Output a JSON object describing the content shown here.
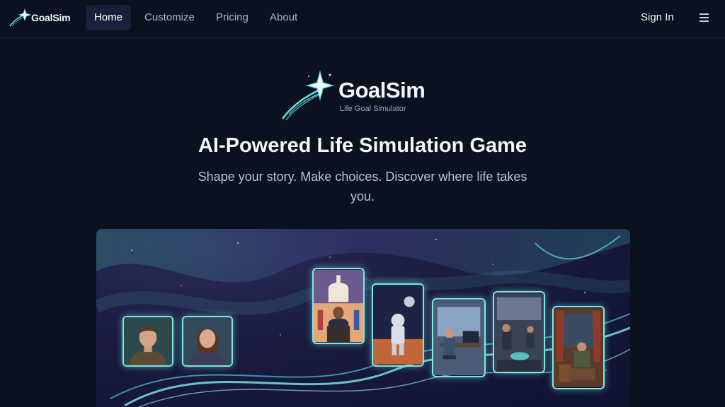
{
  "nav": {
    "brand": "GoalSim",
    "links": [
      {
        "label": "Home",
        "active": true
      },
      {
        "label": "Customize"
      },
      {
        "label": "Pricing"
      },
      {
        "label": "About"
      }
    ],
    "sign_in": "Sign In",
    "menu_icon": "hamburger-icon"
  },
  "hero": {
    "logo_title": "GoalSim",
    "logo_subtitle": "Life Goal Simulator",
    "headline": "AI-Powered Life Simulation Game",
    "subheadline": "Shape your story. Make choices. Discover where life takes you."
  },
  "illustration": {
    "cards": [
      "man-portrait",
      "woman-portrait",
      "politician-podium",
      "astronaut-mars",
      "office-worker",
      "business-meeting",
      "reader-cozy-room"
    ]
  },
  "colors": {
    "background": "#0c1120",
    "accent": "#5fe0d6",
    "nav_active_bg": "#19213a"
  }
}
